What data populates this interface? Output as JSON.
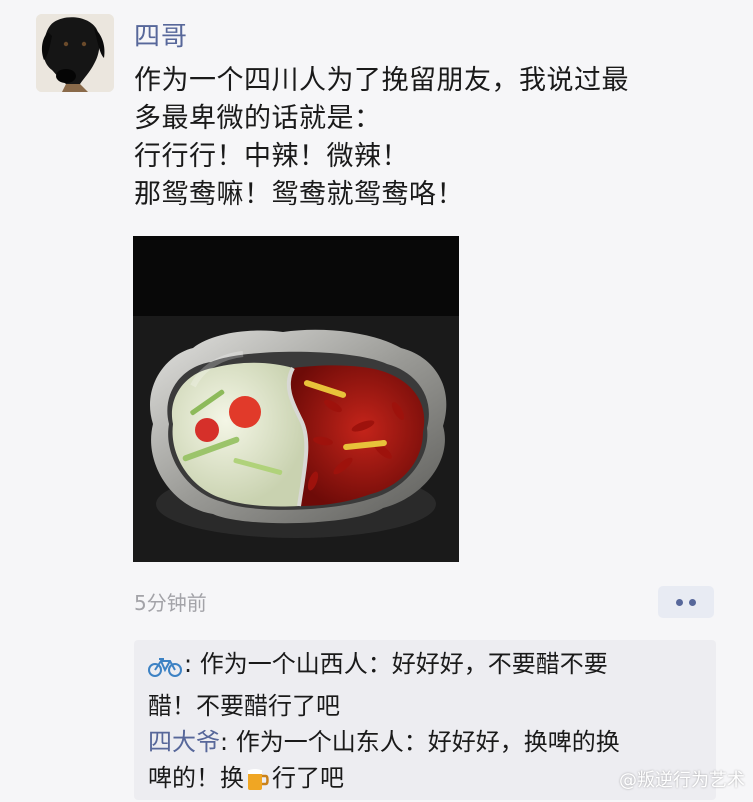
{
  "post": {
    "author": "四哥",
    "lines": [
      "作为一个四川人为了挽留朋友，我说过最",
      "多最卑微的话就是：",
      "行行行！中辣！微辣！",
      "那鸳鸯嘛！鸳鸯就鸳鸯咯！"
    ],
    "timestamp": "5分钟前"
  },
  "comments": [
    {
      "author_icon": "bicycle-icon",
      "lines": [
        ": 作为一个山西人：好好好，不要醋不要",
        "醋！不要醋行了吧"
      ]
    },
    {
      "author": "四大爷",
      "line1": ": 作为一个山东人：好好好，换啤的换",
      "line2_before": "啤的！换",
      "line2_icon": "beer-mug-icon",
      "line2_after": "行了吧"
    }
  ],
  "watermark": "@叛逆行为艺术",
  "colors": {
    "link": "#57679a",
    "background": "#f6f6f8",
    "comment_bg": "#ededf1",
    "timestamp": "#a3a3a8"
  }
}
